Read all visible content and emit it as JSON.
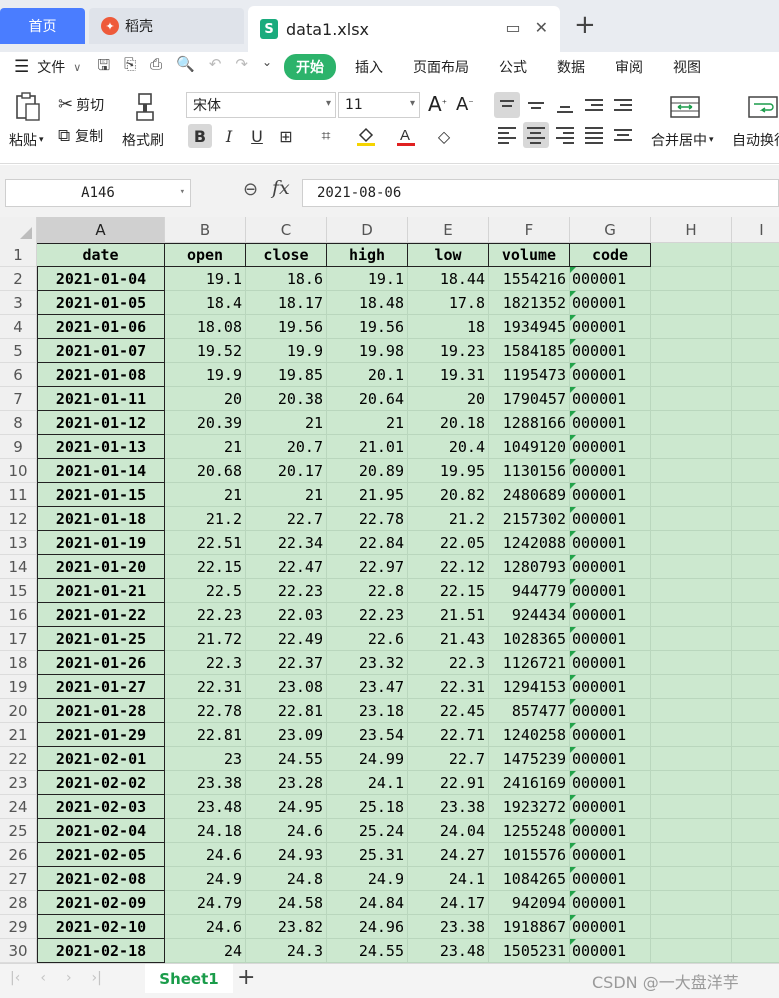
{
  "tabs": {
    "home": "首页",
    "daoke": "稻壳",
    "file": "data1.xlsx"
  },
  "menu": {
    "file": "文件",
    "items": [
      "开始",
      "插入",
      "页面布局",
      "公式",
      "数据",
      "审阅",
      "视图"
    ],
    "active": "开始"
  },
  "ribbon": {
    "paste": "粘贴",
    "cut": "剪切",
    "copy": "复制",
    "format_painter": "格式刷",
    "font_name": "宋体",
    "font_size": "11",
    "merge_center": "合并居中",
    "wrap_text": "自动换行"
  },
  "formula": {
    "cell_ref": "A146",
    "fx": "fx",
    "value": "2021-08-06"
  },
  "columns": [
    "A",
    "B",
    "C",
    "D",
    "E",
    "F",
    "G",
    "H",
    "I"
  ],
  "headers": [
    "date",
    "open",
    "close",
    "high",
    "low",
    "volume",
    "code"
  ],
  "rows": [
    [
      "2021-01-04",
      "19.1",
      "18.6",
      "19.1",
      "18.44",
      "1554216",
      "000001"
    ],
    [
      "2021-01-05",
      "18.4",
      "18.17",
      "18.48",
      "17.8",
      "1821352",
      "000001"
    ],
    [
      "2021-01-06",
      "18.08",
      "19.56",
      "19.56",
      "18",
      "1934945",
      "000001"
    ],
    [
      "2021-01-07",
      "19.52",
      "19.9",
      "19.98",
      "19.23",
      "1584185",
      "000001"
    ],
    [
      "2021-01-08",
      "19.9",
      "19.85",
      "20.1",
      "19.31",
      "1195473",
      "000001"
    ],
    [
      "2021-01-11",
      "20",
      "20.38",
      "20.64",
      "20",
      "1790457",
      "000001"
    ],
    [
      "2021-01-12",
      "20.39",
      "21",
      "21",
      "20.18",
      "1288166",
      "000001"
    ],
    [
      "2021-01-13",
      "21",
      "20.7",
      "21.01",
      "20.4",
      "1049120",
      "000001"
    ],
    [
      "2021-01-14",
      "20.68",
      "20.17",
      "20.89",
      "19.95",
      "1130156",
      "000001"
    ],
    [
      "2021-01-15",
      "21",
      "21",
      "21.95",
      "20.82",
      "2480689",
      "000001"
    ],
    [
      "2021-01-18",
      "21.2",
      "22.7",
      "22.78",
      "21.2",
      "2157302",
      "000001"
    ],
    [
      "2021-01-19",
      "22.51",
      "22.34",
      "22.84",
      "22.05",
      "1242088",
      "000001"
    ],
    [
      "2021-01-20",
      "22.15",
      "22.47",
      "22.97",
      "22.12",
      "1280793",
      "000001"
    ],
    [
      "2021-01-21",
      "22.5",
      "22.23",
      "22.8",
      "22.15",
      "944779",
      "000001"
    ],
    [
      "2021-01-22",
      "22.23",
      "22.03",
      "22.23",
      "21.51",
      "924434",
      "000001"
    ],
    [
      "2021-01-25",
      "21.72",
      "22.49",
      "22.6",
      "21.43",
      "1028365",
      "000001"
    ],
    [
      "2021-01-26",
      "22.3",
      "22.37",
      "23.32",
      "22.3",
      "1126721",
      "000001"
    ],
    [
      "2021-01-27",
      "22.31",
      "23.08",
      "23.47",
      "22.31",
      "1294153",
      "000001"
    ],
    [
      "2021-01-28",
      "22.78",
      "22.81",
      "23.18",
      "22.45",
      "857477",
      "000001"
    ],
    [
      "2021-01-29",
      "22.81",
      "23.09",
      "23.54",
      "22.71",
      "1240258",
      "000001"
    ],
    [
      "2021-02-01",
      "23",
      "24.55",
      "24.99",
      "22.7",
      "1475239",
      "000001"
    ],
    [
      "2021-02-02",
      "23.38",
      "23.28",
      "24.1",
      "22.91",
      "2416169",
      "000001"
    ],
    [
      "2021-02-03",
      "23.48",
      "24.95",
      "25.18",
      "23.38",
      "1923272",
      "000001"
    ],
    [
      "2021-02-04",
      "24.18",
      "24.6",
      "25.24",
      "24.04",
      "1255248",
      "000001"
    ],
    [
      "2021-02-05",
      "24.6",
      "24.93",
      "25.31",
      "24.27",
      "1015576",
      "000001"
    ],
    [
      "2021-02-08",
      "24.9",
      "24.8",
      "24.9",
      "24.1",
      "1084265",
      "000001"
    ],
    [
      "2021-02-09",
      "24.79",
      "24.58",
      "24.84",
      "24.17",
      "942094",
      "000001"
    ],
    [
      "2021-02-10",
      "24.6",
      "23.82",
      "24.96",
      "23.38",
      "1918867",
      "000001"
    ],
    [
      "2021-02-18",
      "24",
      "24.3",
      "24.55",
      "23.48",
      "1505231",
      "000001"
    ]
  ],
  "sheet_tab": "Sheet1",
  "watermark": "CSDN @一大盘洋芋"
}
